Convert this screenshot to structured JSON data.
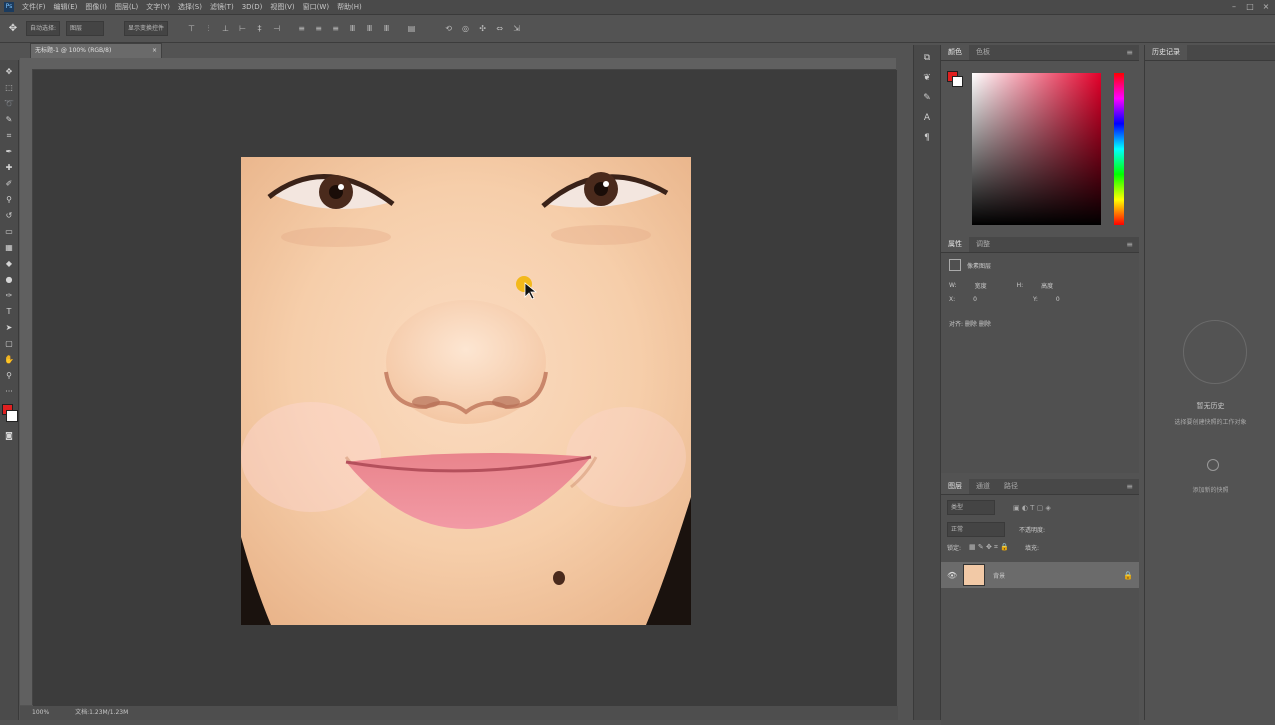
{
  "menubar": {
    "app_logo": "Ps",
    "items": [
      "文件(F)",
      "编辑(E)",
      "图像(I)",
      "图层(L)",
      "文字(Y)",
      "选择(S)",
      "滤镜(T)",
      "3D(D)",
      "视图(V)",
      "窗口(W)",
      "帮助(H)"
    ]
  },
  "options_bar": {
    "tool_preset": "自动选择:",
    "target": "图层",
    "transform_label": "显示变换控件"
  },
  "document": {
    "tab_title": "无标题-1 @ 100% (RGB/8)",
    "close_glyph": "×"
  },
  "status": {
    "zoom": "100%",
    "doc_info": "文档:1.23M/1.23M"
  },
  "color_panel": {
    "tabs": [
      "颜色",
      "色板"
    ],
    "fg_color": "#e02020",
    "bg_color": "#ffffff"
  },
  "properties_panel": {
    "tabs": [
      "属性",
      "调整"
    ],
    "title": "像素图层",
    "w_label": "W:",
    "w_value": "宽度",
    "h_label": "H:",
    "h_value": "高度",
    "x_label": "X:",
    "x_value": "0",
    "y_label": "Y:",
    "y_value": "0",
    "mode_label": "对齐: 删除 删除"
  },
  "layers_panel": {
    "tabs": [
      "图层",
      "通道",
      "路径"
    ],
    "filter_label": "类型",
    "blend_mode": "正常",
    "opacity_label": "不透明度:",
    "lock_label": "锁定:",
    "fill_label": "填充:",
    "layer_name": "背景"
  },
  "history_panel": {
    "tab": "历史记录",
    "hint_title": "暂无历史",
    "hint_text": "选择要创建快照的工作对象",
    "hint_sub": "添加新的快照"
  }
}
